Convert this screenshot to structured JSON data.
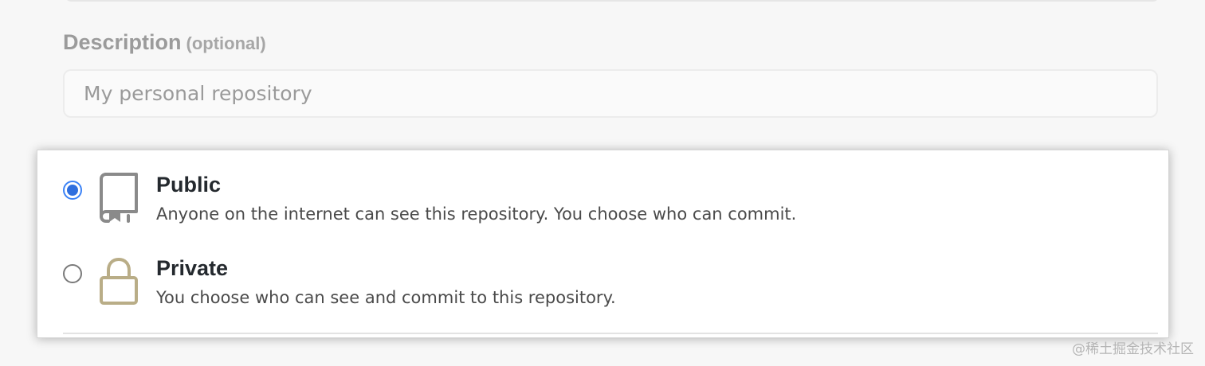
{
  "description": {
    "label": "Description",
    "optional_label": "(optional)",
    "placeholder": "My personal repository",
    "value": ""
  },
  "visibility": {
    "options": [
      {
        "title": "Public",
        "description": "Anyone on the internet can see this repository. You choose who can commit.",
        "icon": "repo-book-icon",
        "selected": true
      },
      {
        "title": "Private",
        "description": "You choose who can see and commit to this repository.",
        "icon": "lock-icon",
        "selected": false
      }
    ]
  },
  "colors": {
    "radio_accent": "#2f6fde",
    "book_icon": "#8a8a8a",
    "lock_icon": "#b9ad87",
    "title_text": "#24292e"
  },
  "watermark": "@稀土掘金技术社区"
}
